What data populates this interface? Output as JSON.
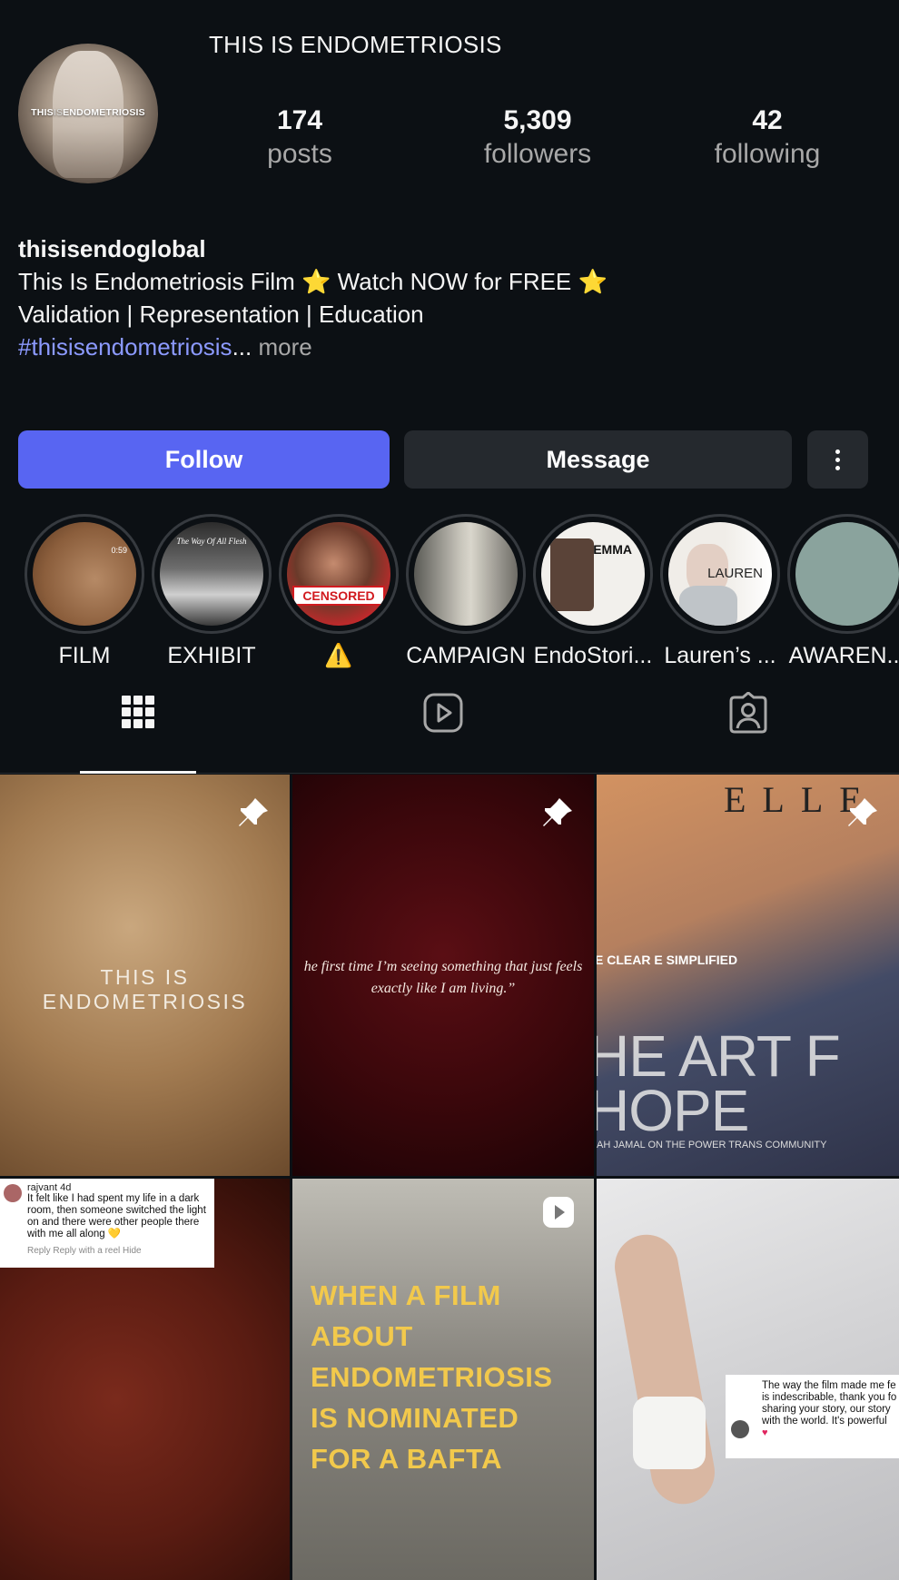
{
  "profile": {
    "display_name": "THIS IS ENDOMETRIOSIS",
    "avatar_text_1": "THIS",
    "avatar_text_2": "IS",
    "avatar_text_3": "ENDOMETRIOSIS",
    "username": "thisisendoglobal",
    "bio_line1": "This Is Endometriosis Film ⭐ Watch NOW for FREE ⭐",
    "bio_line2": "Validation | Representation | Education",
    "bio_hashtag": "#thisisendometriosis",
    "bio_ellipsis": "...",
    "bio_more": " more"
  },
  "stats": [
    {
      "value": "174",
      "label": "posts"
    },
    {
      "value": "5,309",
      "label": "followers"
    },
    {
      "value": "42",
      "label": "following"
    }
  ],
  "actions": {
    "follow_label": "Follow",
    "message_label": "Message",
    "more_icon": "more-vertical-icon",
    "follow_color": "#5865f2"
  },
  "highlights": [
    {
      "label": "FILM",
      "tag": "0:59"
    },
    {
      "label": "EXHIBIT",
      "tag": "The Way Of All Flesh"
    },
    {
      "label": "⚠️",
      "tag": "CENSORED"
    },
    {
      "label": "CAMPAIGN"
    },
    {
      "label": "EndoStori...",
      "tag": "EMMA"
    },
    {
      "label": "Lauren’s ...",
      "tag": "LAUREN"
    },
    {
      "label": "AWAREN..."
    }
  ],
  "tabs": [
    {
      "icon": "grid-icon",
      "active": true
    },
    {
      "icon": "reels-icon",
      "active": false
    },
    {
      "icon": "tagged-icon",
      "active": false
    }
  ],
  "posts": {
    "p1_title": "THIS IS ENDOMETRIOSIS",
    "p2_quote": "he first time I’m seeing something that just feels exactly like I am living.”",
    "p3_mast": "ELLE",
    "p3_small": "E CLEAR E SIMPLIFIED",
    "p3_big": "HE ART F HOPE",
    "p3_caption": "AH JAMAL ON THE POWER TRANS COMMUNITY",
    "p4_comment_user": "rajvant 4d",
    "p4_comment_body": "It felt like I had spent my life in a dark room, then someone switched the light on and there were other people there with me all along 💛",
    "p4_comment_actions": "Reply     Reply with a reel     Hide",
    "p5_headline": "WHEN A FILM ABOUT ENDOMETRIOSIS IS NOMINATED FOR A BAFTA",
    "p6_comment": "The way the film made me fe is indescribable, thank you fo sharing your story, our story with the world. It's powerful",
    "p6_heart": "♥"
  }
}
